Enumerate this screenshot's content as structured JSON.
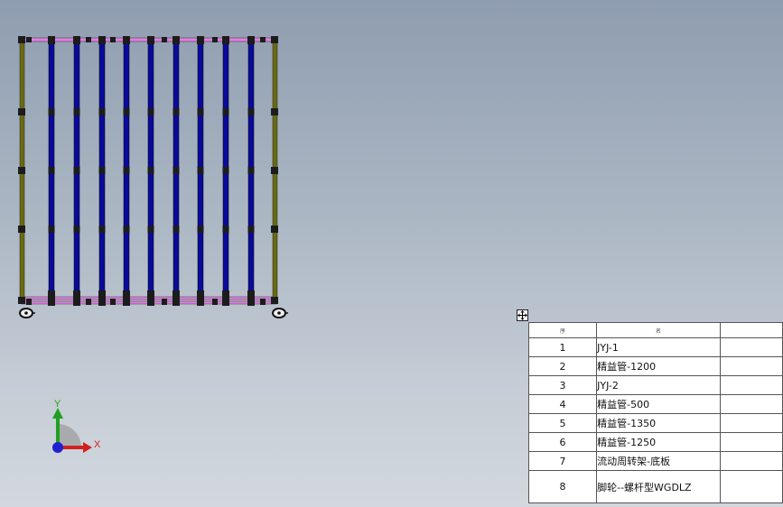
{
  "colors": {
    "background_top": "#8f9db0",
    "background_bottom": "#d3d8de",
    "vertical_tube": "#0a0a9a",
    "side_tube": "#6b6a10",
    "cross_tube": "#e080e0",
    "connector": "#1c1c1c",
    "axis_x": "#d02020",
    "axis_y": "#20a020",
    "axis_z": "#2020d0"
  },
  "triad": {
    "x_label": "X",
    "y_label": "Y"
  },
  "bom": {
    "header": {
      "no": "序",
      "name": "名"
    },
    "rows": [
      {
        "no": "1",
        "name": "JYJ-1"
      },
      {
        "no": "2",
        "name": "精益管-1200"
      },
      {
        "no": "3",
        "name": "JYJ-2"
      },
      {
        "no": "4",
        "name": "精益管-500"
      },
      {
        "no": "5",
        "name": "精益管-1350"
      },
      {
        "no": "6",
        "name": "精益管-1250"
      },
      {
        "no": "7",
        "name": "流动周转架-底板"
      },
      {
        "no": "8",
        "name": "脚轮--螺杆型WGDLZ"
      }
    ]
  },
  "icons": {
    "table_handle": "move-handle-icon",
    "triad": "axis-triad-icon",
    "caster": "caster-wheel-icon"
  }
}
